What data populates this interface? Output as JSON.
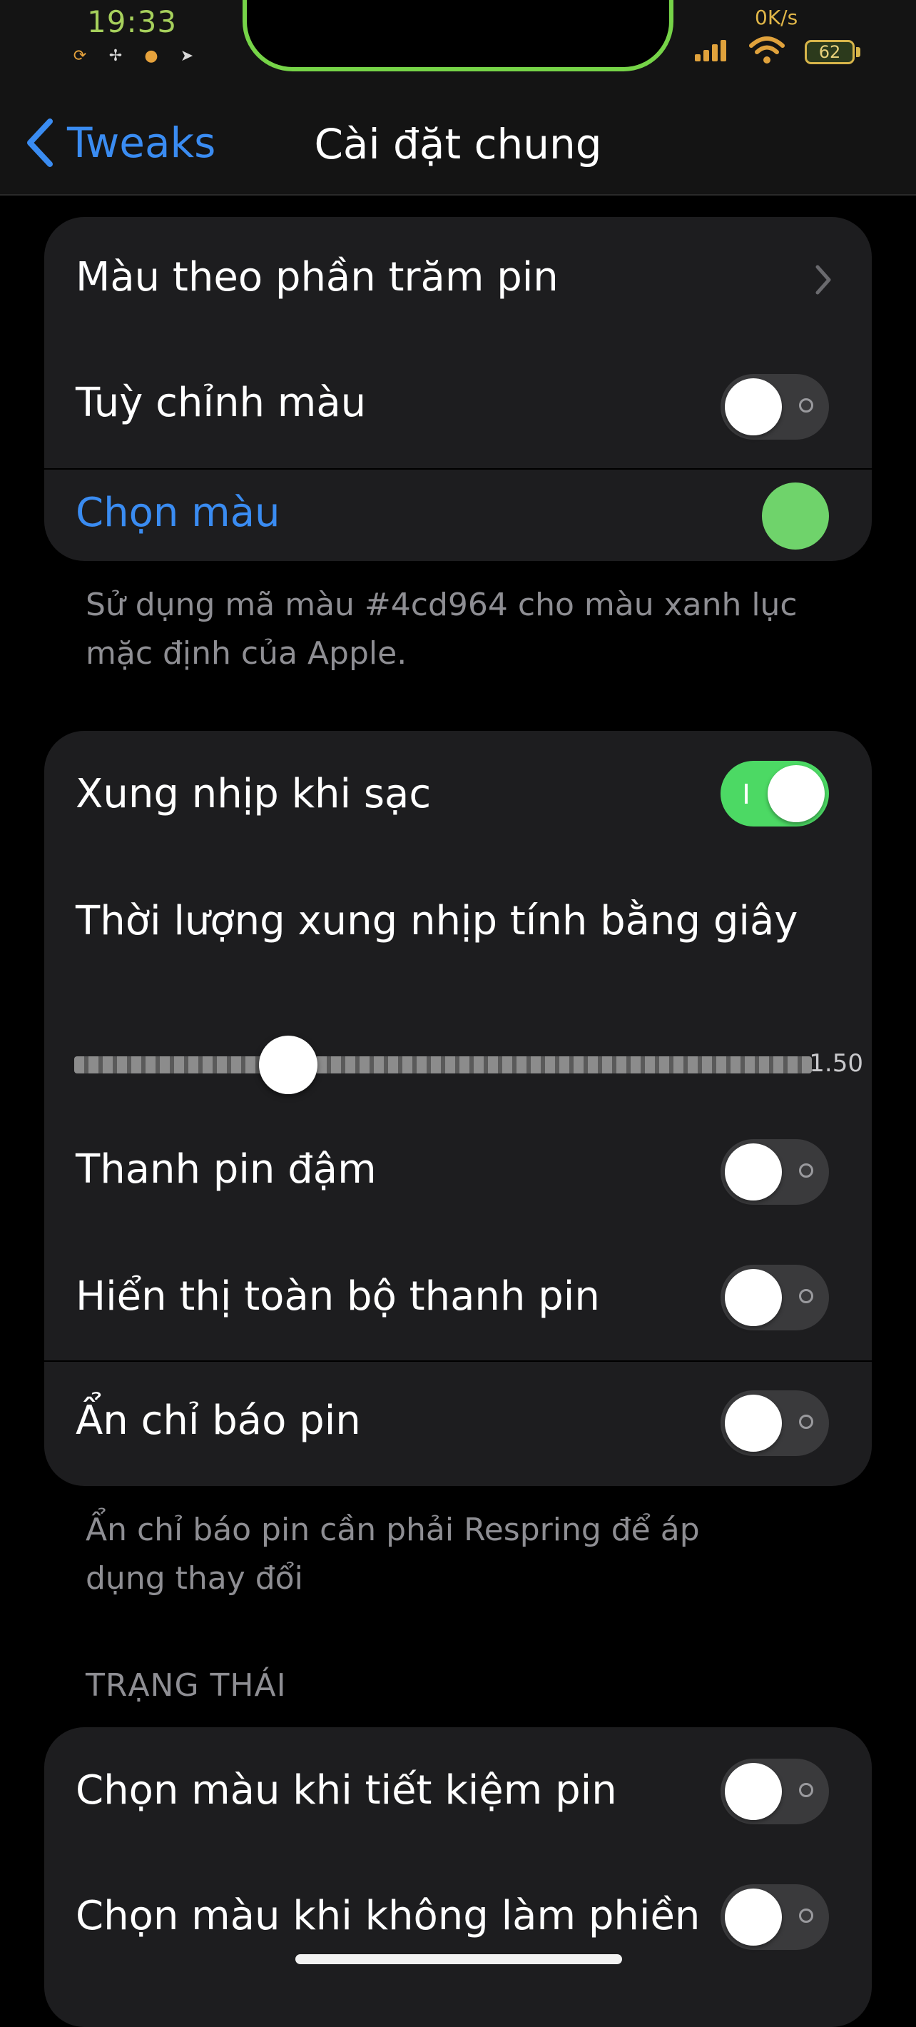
{
  "status_bar": {
    "time": "19:33",
    "net_speed": "0K/s",
    "battery_level": "62",
    "icons_left": [
      "refresh-icon",
      "fan-icon",
      "coin-icon",
      "location-arrow-icon"
    ],
    "accent_color": "#a6d05c"
  },
  "nav": {
    "back_label": "Tweaks",
    "title": "Cài đặt chung"
  },
  "group1": {
    "battery_percent_color_label": "Màu theo phần trăm pin",
    "custom_color_label": "Tuỳ chỉnh màu",
    "custom_color_enabled": false,
    "pick_color_label": "Chọn màu",
    "picked_color": "#6fd36b",
    "footer": "Sử dụng mã màu #4cd964 cho màu xanh lục mặc định của Apple."
  },
  "group2": {
    "pulse_charging_label": "Xung nhịp khi sạc",
    "pulse_charging_enabled": true,
    "pulse_duration_label": "Thời lượng xung nhịp tính bằng giây",
    "pulse_duration_value": "1.50",
    "pulse_slider_fraction": 0.29,
    "bold_bar_label": "Thanh pin đậm",
    "bold_bar_enabled": false,
    "full_bar_label": "Hiển thị toàn bộ thanh pin",
    "full_bar_enabled": false,
    "hide_indicator_label": "Ẩn chỉ báo pin",
    "hide_indicator_enabled": false,
    "footer": "Ẩn chỉ báo pin cần phải Respring để áp dụng thay đổi"
  },
  "section_status": {
    "header": "TRẠNG THÁI",
    "low_power_color_label": "Chọn màu khi tiết kiệm pin",
    "low_power_color_enabled": false,
    "dnd_color_label": "Chọn màu khi không làm phiền",
    "dnd_color_enabled": false
  },
  "colors": {
    "link_blue": "#3a8cf2",
    "toggle_on": "#4cd964",
    "toggle_off": "#3a3a3c",
    "cell_background": "#1d1d1f",
    "secondary_text": "#8e8e93"
  }
}
